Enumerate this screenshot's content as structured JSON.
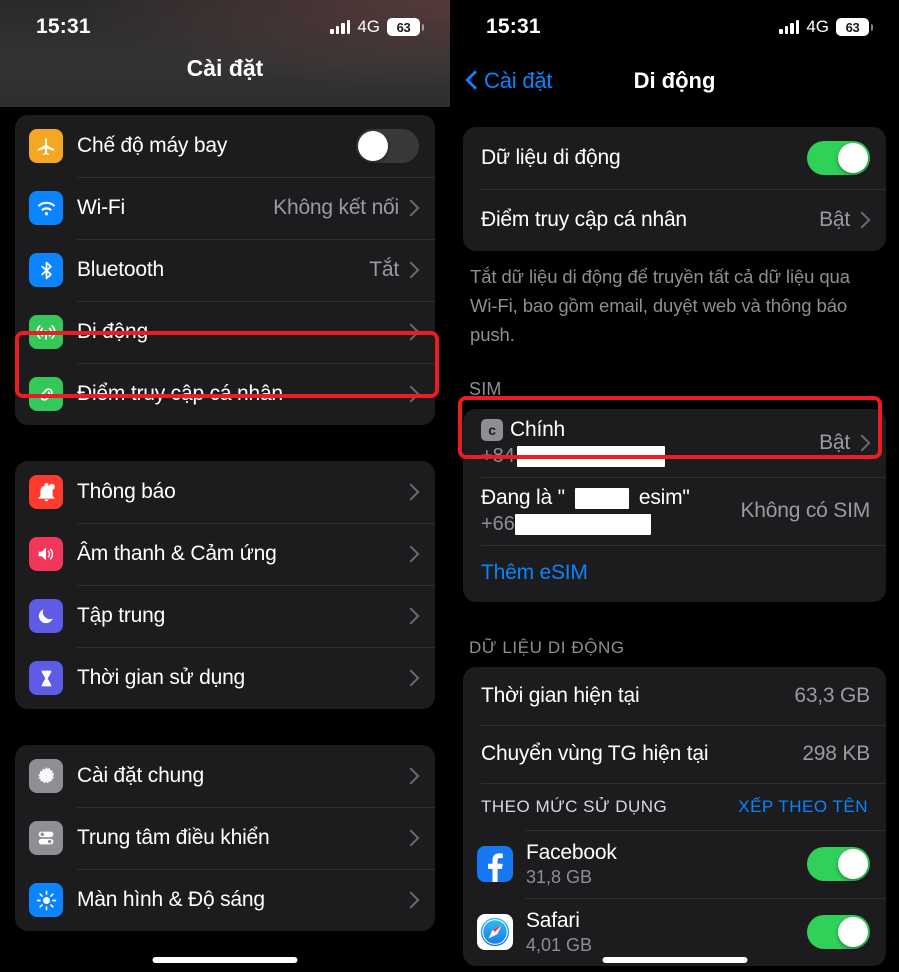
{
  "status_bar": {
    "time": "15:31",
    "network": "4G",
    "battery": "63",
    "signal_icon": "cellular-bars-icon"
  },
  "left_panel": {
    "title": "Cài đặt",
    "groups": [
      {
        "items": [
          {
            "label": "Chế độ máy bay",
            "icon": "airplane-icon",
            "icon_color": "#f5a623",
            "control": "toggle",
            "toggle_on": false
          },
          {
            "label": "Wi-Fi",
            "icon": "wifi-icon",
            "icon_color": "#0a84ff",
            "control": "value",
            "value": "Không kết nối"
          },
          {
            "label": "Bluetooth",
            "icon": "bluetooth-icon",
            "icon_color": "#0a84ff",
            "control": "value",
            "value": "Tắt"
          },
          {
            "label": "Di động",
            "icon": "cellular-icon",
            "icon_color": "#34c759",
            "control": "chevron",
            "value": "",
            "highlighted": true
          },
          {
            "label": "Điểm truy cập cá nhân",
            "icon": "hotspot-link-icon",
            "icon_color": "#34c759",
            "control": "chevron",
            "value": ""
          }
        ]
      },
      {
        "items": [
          {
            "label": "Thông báo",
            "icon": "bell-icon",
            "icon_color": "#ff3b30",
            "control": "chevron",
            "value": ""
          },
          {
            "label": "Âm thanh & Cảm ứng",
            "icon": "speaker-icon",
            "icon_color": "#f2385a",
            "control": "chevron",
            "value": ""
          },
          {
            "label": "Tập trung",
            "icon": "moon-icon",
            "icon_color": "#5e5ce6",
            "control": "chevron",
            "value": ""
          },
          {
            "label": "Thời gian sử dụng",
            "icon": "hourglass-icon",
            "icon_color": "#5e5ce6",
            "control": "chevron",
            "value": ""
          }
        ]
      },
      {
        "items": [
          {
            "label": "Cài đặt chung",
            "icon": "gear-icon",
            "icon_color": "#8e8e93",
            "control": "chevron",
            "value": ""
          },
          {
            "label": "Trung tâm điều khiển",
            "icon": "control-center-icon",
            "icon_color": "#8e8e93",
            "control": "chevron",
            "value": ""
          },
          {
            "label": "Màn hình & Độ sáng",
            "icon": "brightness-icon",
            "icon_color": "#0a84ff",
            "control": "chevron",
            "value": ""
          }
        ]
      }
    ]
  },
  "right_panel": {
    "back_label": "Cài đặt",
    "title": "Di động",
    "data_section": {
      "mobile_data_label": "Dữ liệu di động",
      "mobile_data_on": true,
      "hotspot_label": "Điểm truy cập cá nhân",
      "hotspot_value": "Bật",
      "footer": "Tắt dữ liệu di động để truyền tất cả dữ liệu qua Wi-Fi, bao gồm email, duyệt web và thông báo push."
    },
    "sim_section": {
      "header": "SIM",
      "primary": {
        "badge": "c",
        "name": "Chính",
        "prefix": "+84",
        "redacted": true,
        "value": "Bật",
        "highlighted": true
      },
      "secondary": {
        "name_prefix": "Đang là \"",
        "name_suffix": " esim\"",
        "prefix": "+66",
        "redacted": true,
        "value": "Không có SIM"
      },
      "add_esim_label": "Thêm eSIM"
    },
    "usage_section": {
      "header": "DỮ LIỆU DI ĐỘNG",
      "rows": [
        {
          "label": "Thời gian hiện tại",
          "value": "63,3 GB"
        },
        {
          "label": "Chuyển vùng TG hiện tại",
          "value": "298 KB"
        }
      ],
      "sub_header_left": "THEO MỨC SỬ DỤNG",
      "sub_header_right": "XẾP THEO TÊN",
      "apps": [
        {
          "name": "Facebook",
          "usage": "31,8 GB",
          "icon": "facebook-icon",
          "toggle_on": true
        },
        {
          "name": "Safari",
          "usage": "4,01 GB",
          "icon": "safari-icon",
          "toggle_on": true
        }
      ]
    }
  },
  "colors": {
    "accent_blue": "#0a84ff",
    "toggle_green": "#30d158",
    "highlight_red": "#ec1c24",
    "card_bg": "#1c1c1e",
    "page_bg": "#000000"
  }
}
